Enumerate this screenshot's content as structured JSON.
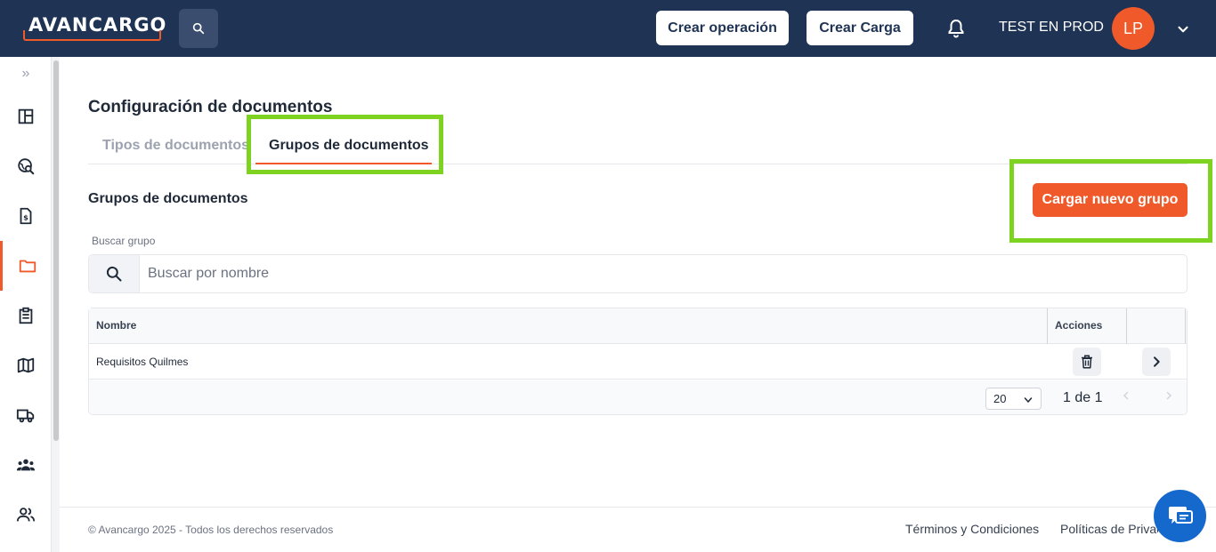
{
  "header": {
    "logo_text": "AVANCARGO",
    "create_operation_label": "Crear operación",
    "create_load_label": "Crear Carga",
    "user_name": "TEST EN PROD",
    "avatar_initials": "LP"
  },
  "sidebar": {
    "expand_label": "»",
    "items": [
      {
        "name": "dashboard-icon"
      },
      {
        "name": "tracking-search-icon"
      },
      {
        "name": "invoice-icon"
      },
      {
        "name": "folder-icon",
        "active": true
      },
      {
        "name": "clipboard-icon"
      },
      {
        "name": "map-icon"
      },
      {
        "name": "truck-icon"
      },
      {
        "name": "groups-icon"
      },
      {
        "name": "users-icon"
      }
    ]
  },
  "main": {
    "page_title": "Configuración de documentos",
    "tabs": [
      {
        "label": "Tipos de documentos",
        "active": false
      },
      {
        "label": "Grupos de documentos",
        "active": true
      }
    ],
    "section_title": "Grupos de documentos",
    "new_group_button": "Cargar nuevo grupo",
    "search": {
      "label": "Buscar grupo",
      "placeholder": "Buscar por nombre",
      "value": ""
    },
    "table": {
      "columns": [
        "Nombre",
        "Acciones"
      ],
      "rows": [
        {
          "name": "Requisitos Quilmes"
        }
      ],
      "page_size": "20",
      "page_info": "1 de 1"
    }
  },
  "footer": {
    "copyright": "© Avancargo 2025 - Todos los derechos reservados",
    "terms": "Términos y Condiciones",
    "privacy": "Políticas de Privacidad"
  },
  "colors": {
    "header_bg": "#1f3354",
    "accent": "#f0592a",
    "highlight": "#7ed321",
    "chat": "#1669cc"
  }
}
